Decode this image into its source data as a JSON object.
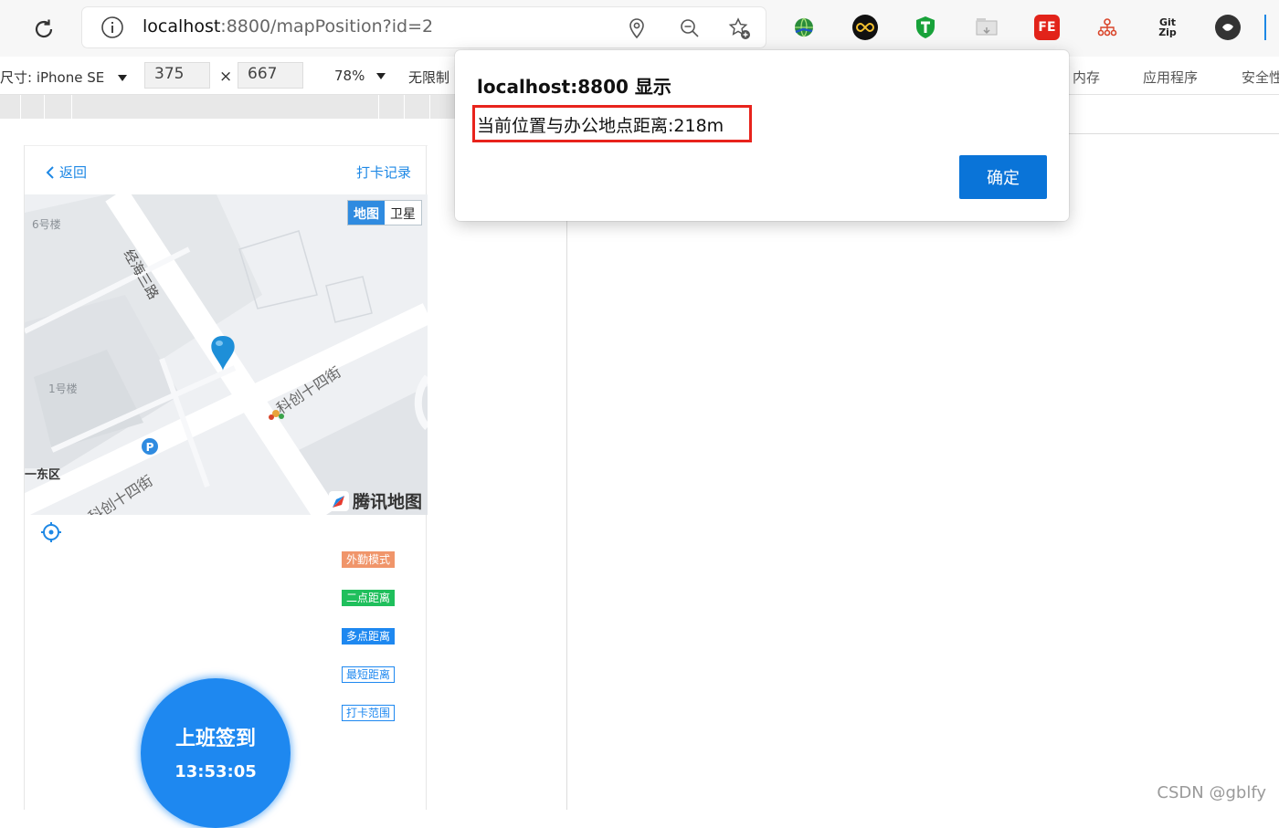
{
  "browser": {
    "url_host": "localhost",
    "url_path": ":8800/mapPosition?id=2",
    "extensions": [
      "globe-extension",
      "infinity-extension",
      "shield-t-extension",
      "tab-extension",
      "fe-extension",
      "tree-extension",
      "git-zip-extension",
      "circle-extension"
    ],
    "ext_labels": {
      "fe": "FE",
      "git": "Git",
      "zip": "Zip"
    }
  },
  "devtools": {
    "device_label": "尺寸: iPhone SE",
    "width": "375",
    "times": "×",
    "height": "667",
    "zoom": "78%",
    "throttle": "无限制",
    "tabs": [
      "内存",
      "应用程序",
      "安全性"
    ]
  },
  "app": {
    "back_label": "返回",
    "record_label": "打卡记录",
    "map_type_map": "地图",
    "map_type_satellite": "卫星",
    "map_logo": "腾讯地图",
    "map_labels": {
      "building6": "6号楼",
      "building1": "1号楼",
      "road1": "经海三路",
      "road2": "科创十四街",
      "road3": "科创十四街",
      "district": "一东区"
    },
    "tags": [
      {
        "label": "外勤模式",
        "color": "#f0956a"
      },
      {
        "label": "二点距离",
        "color": "#1fbf5c"
      },
      {
        "label": "多点距离",
        "color": "#1e88f0"
      },
      {
        "label": "最短距离",
        "color": "#1e88f0"
      },
      {
        "label": "打卡范围",
        "color": "#1e88f0"
      }
    ],
    "checkin_label": "上班签到",
    "checkin_time": "13:53:05"
  },
  "dialog": {
    "title": "localhost:8800 显示",
    "message": "当前位置与办公地点距离:218m",
    "ok_label": "确定"
  },
  "watermark": "CSDN @gblfy"
}
